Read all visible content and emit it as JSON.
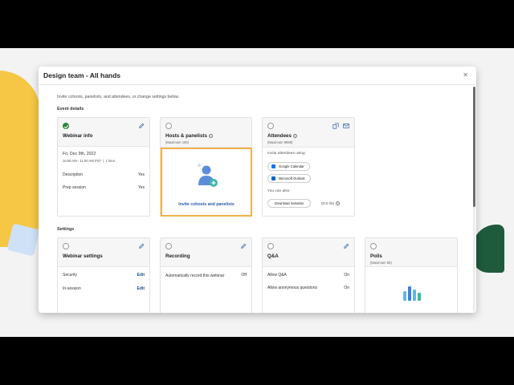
{
  "modal": {
    "title": "Design team - All hands",
    "close_icon": "close-icon"
  },
  "intro": "Invite cohosts, panelists, and attendees, or change settings below.",
  "sections": {
    "event_details": "Event details",
    "settings": "Settings"
  },
  "webinar_info": {
    "title": "Webinar info",
    "date": "Fri, Dec 9th, 2022",
    "time": "10:00 AM - 11:00 AM PST",
    "duration": "1 hour",
    "rows": [
      {
        "label": "Description",
        "value": "Yes"
      },
      {
        "label": "Prep session",
        "value": "Yes"
      }
    ]
  },
  "hosts": {
    "title": "Hosts & panelists",
    "sub": "(Maximum 100)",
    "invite": "Invite cohosts and panelists"
  },
  "attendees": {
    "title": "Attendees",
    "sub": "(Maximum 9999)",
    "invite_label": "Invite attendees using",
    "google": "Google Calendar",
    "outlook": "Microsoft Outlook",
    "also": "You can also",
    "download": "Download invitation",
    "ics": "(ICS file)"
  },
  "webinar_settings": {
    "title": "Webinar settings",
    "rows": [
      {
        "label": "Security",
        "value": "Edit"
      },
      {
        "label": "In-session",
        "value": "Edit"
      }
    ]
  },
  "recording": {
    "title": "Recording",
    "label": "Automatically record this webinar",
    "value": "Off"
  },
  "qa": {
    "title": "Q&A",
    "rows": [
      {
        "label": "Allow Q&A",
        "value": "On"
      },
      {
        "label": "Allow anonymous questions",
        "value": "On"
      }
    ]
  },
  "polls": {
    "title": "Polls",
    "sub": "(Maximum 50)"
  },
  "colors": {
    "accent": "#2a5ea8",
    "highlight": "#f1b24a",
    "success": "#2e8540"
  }
}
